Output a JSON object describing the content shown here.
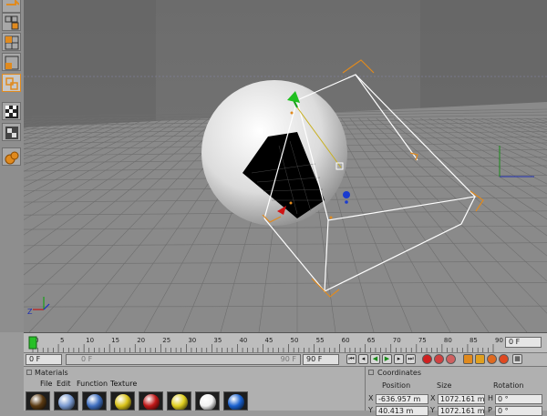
{
  "toolbar": {
    "tools": [
      "move-tool",
      "scale-tool",
      "polygon-tool",
      "edge-tool",
      "object-tool",
      "texture-tool",
      "axis-tool",
      "material-tool"
    ]
  },
  "viewport": {
    "axis_label_z": "Z"
  },
  "timeline": {
    "ticks": [
      "0",
      "5",
      "10",
      "15",
      "20",
      "25",
      "30",
      "35",
      "40",
      "45",
      "50",
      "55",
      "60",
      "65",
      "70",
      "75",
      "80",
      "85",
      "90"
    ],
    "current_frame": "0 F",
    "end_frame_field": "0 F"
  },
  "transport": {
    "start_field": "0 F",
    "range_start": "0 F",
    "range_end": "90 F",
    "end_field": "90 F"
  },
  "materials": {
    "title": "Materials",
    "menu": [
      "File",
      "Edit",
      "Function",
      "Texture"
    ],
    "swatches": [
      {
        "name": "dark-brown",
        "color": "#5a3a12"
      },
      {
        "name": "blue-sky",
        "color": "#7a9ad0"
      },
      {
        "name": "blue-chrome",
        "color": "#3f6fc0"
      },
      {
        "name": "gold",
        "color": "#d9c21a"
      },
      {
        "name": "red",
        "color": "#c01818"
      },
      {
        "name": "yellow",
        "color": "#e0d020"
      },
      {
        "name": "white",
        "color": "#f2f2f2"
      },
      {
        "name": "blue",
        "color": "#1a62d0"
      }
    ]
  },
  "coordinates": {
    "title": "Coordinates",
    "headers": {
      "position": "Position",
      "size": "Size",
      "rotation": "Rotation"
    },
    "row_x": {
      "label": "X",
      "position": "-636.957 m",
      "size": "1072.161 m",
      "rot_label": "H",
      "rotation": "0 °"
    },
    "row_y": {
      "label": "Y",
      "position": "40.413 m",
      "size": "1072.161 m",
      "rot_label": "P",
      "rotation": "0 °"
    }
  },
  "colors": {
    "accent": "#e08a1e",
    "selection": "#ffffff"
  }
}
